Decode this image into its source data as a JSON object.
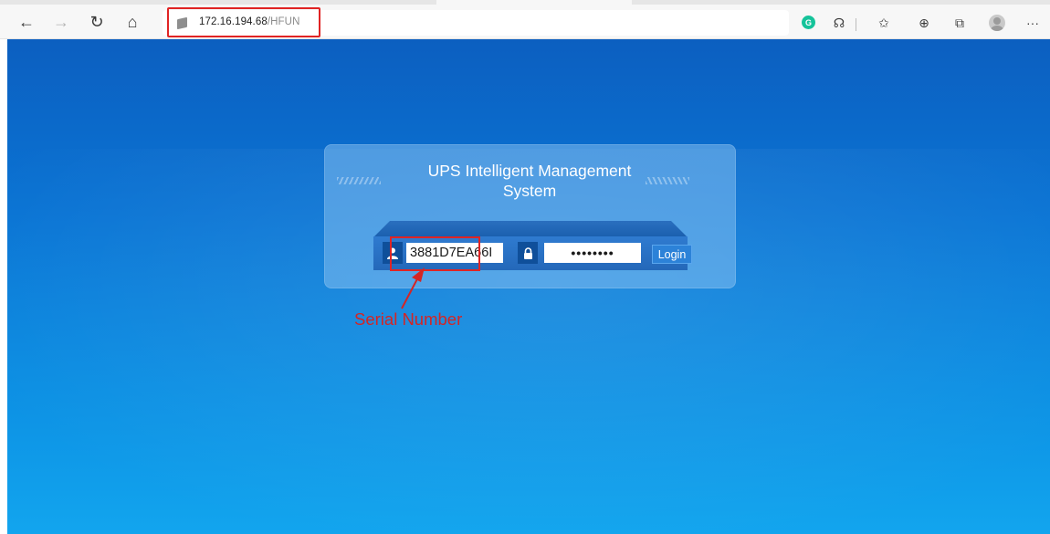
{
  "browser": {
    "url_host": "172.16.194.68",
    "url_path": "/HFUN",
    "nav": {
      "back_icon": "←",
      "forward_icon": "→",
      "refresh_icon": "↻",
      "home_icon": "⌂"
    },
    "extension_letter": "G",
    "tools": {
      "ext2_icon": "☊",
      "favorites_icon": "✩",
      "collections_icon": "⊕",
      "sidebar_icon": "⧉",
      "more_icon": "···"
    }
  },
  "login": {
    "title": "UPS Intelligent Management System",
    "serial_value": "3881D7EA66I",
    "password_value": "••••••••",
    "login_label": "Login",
    "user_icon": "user-icon",
    "lock_icon": "lock-icon"
  },
  "annotation": {
    "label": "Serial Number",
    "color": "#d42525"
  }
}
